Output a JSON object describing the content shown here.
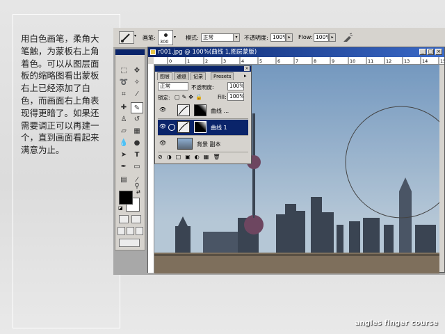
{
  "tutorial": {
    "text": "用白色画笔，柔角大笔触，为蒙板右上角着色。可以从图层面板的缩略图看出蒙板右上已经添加了白色，而画面右上角表现得更暗了。如果还需要调正可以再建一个，直到画面看起来满意为止。"
  },
  "credit": "angles finger course",
  "options_bar": {
    "brush_label": "画笔:",
    "brush_size": "300",
    "mode_label": "模式:",
    "mode_value": "正常",
    "opacity_label": "不透明度:",
    "opacity_value": "100%",
    "flow_label": "Flow:",
    "flow_value": "100%"
  },
  "document": {
    "title": "r001.jpg @ 100%(曲线 1,图层蒙版)",
    "ruler_numbers": [
      "0",
      "1",
      "2",
      "3",
      "4",
      "5",
      "6",
      "7",
      "8",
      "9",
      "10",
      "11",
      "12",
      "13",
      "14",
      "15"
    ]
  },
  "layers_panel": {
    "tabs": [
      "图层",
      "通道",
      "记录",
      "Presets"
    ],
    "blend_mode": "正常",
    "opacity_label": "不透明度:",
    "opacity_value": "100%",
    "lock_label": "锁定:",
    "fill_label": "Fill:",
    "fill_value": "100%",
    "layers": [
      {
        "name": "曲线 ...",
        "selected": false
      },
      {
        "name": "曲线 1",
        "selected": true
      },
      {
        "name": "背景 副本",
        "selected": false
      }
    ]
  },
  "colors": {
    "accent": "#0a246a",
    "sky_top": "#7fa6cf",
    "sky_bottom": "#c9dbe9"
  }
}
